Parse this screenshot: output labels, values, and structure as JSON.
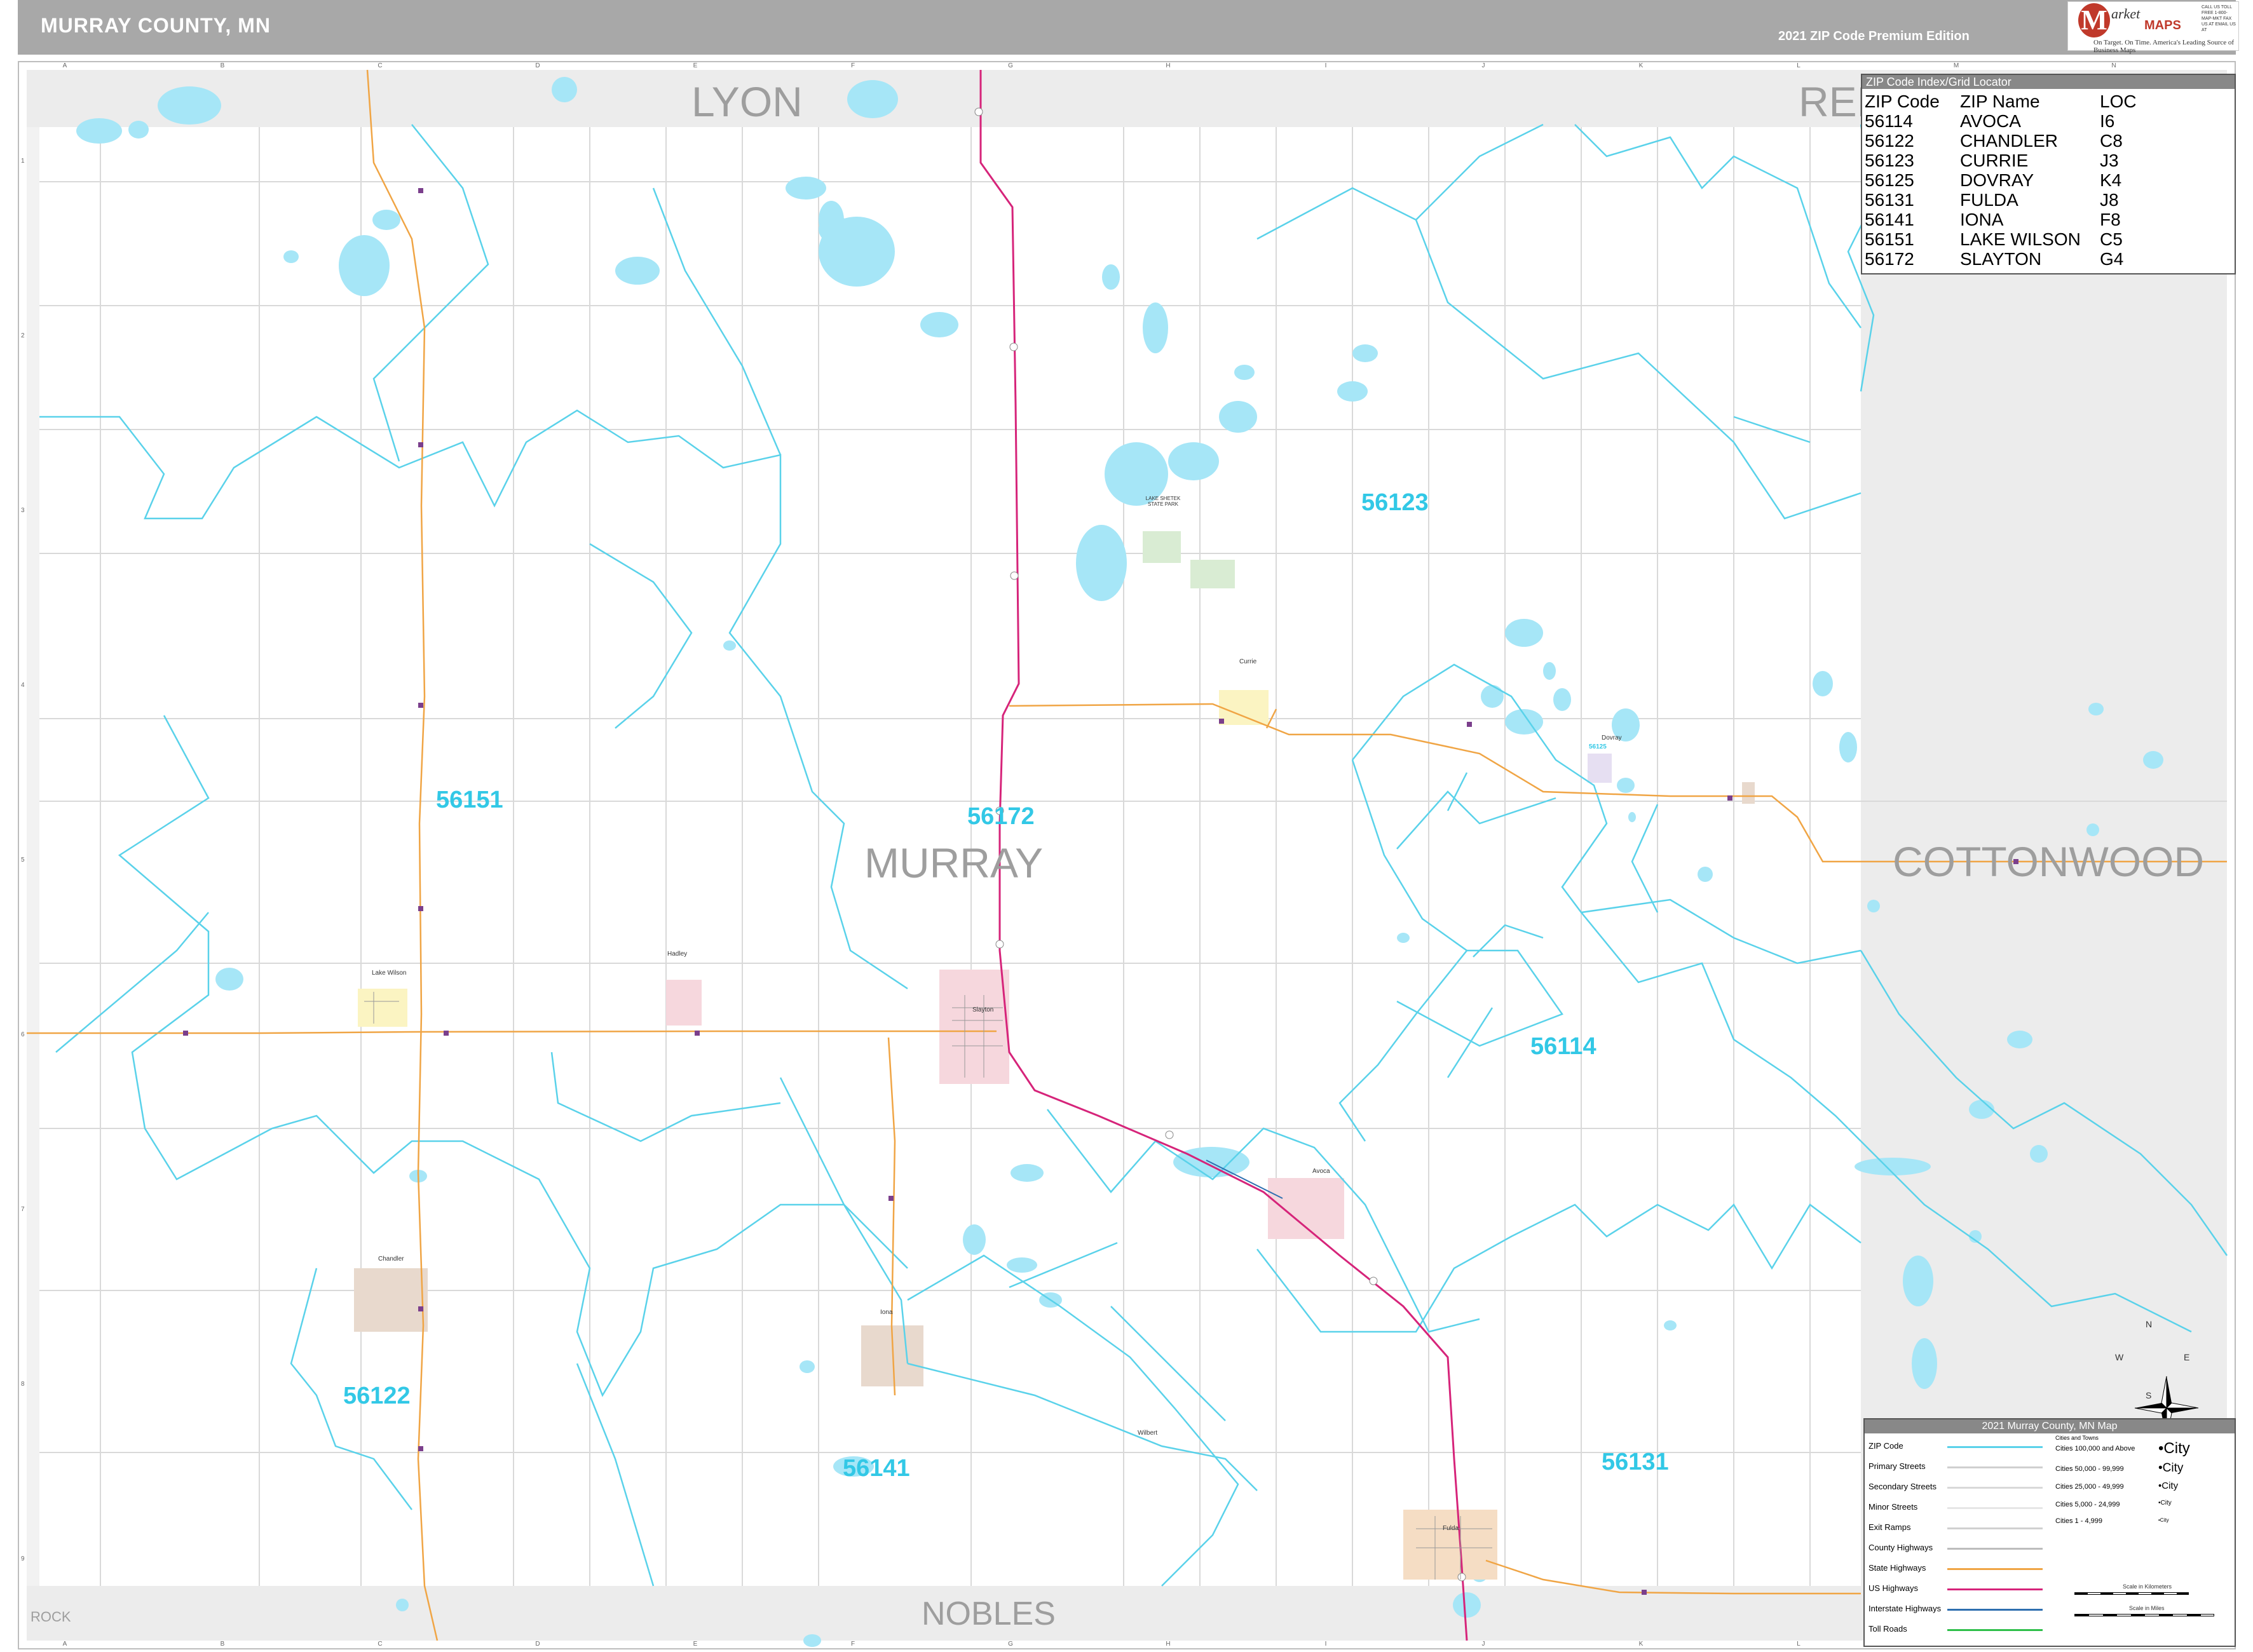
{
  "header": {
    "title": "MURRAY COUNTY, MN",
    "edition": "2021 ZIP Code Premium Edition"
  },
  "logo": {
    "letter": "M",
    "brand_line1": "arket",
    "brand_line2": "MAPS",
    "tagline": "On Target. On Time. America's Leading Source of Business Maps",
    "contact": "CALL US TOLL FREE 1-800-MAP-MKT FAX US AT EMAIL US AT"
  },
  "grid": {
    "columns": [
      "A",
      "B",
      "C",
      "D",
      "E",
      "F",
      "G",
      "H",
      "I",
      "J",
      "K",
      "L",
      "M",
      "N"
    ],
    "rows": [
      "1",
      "2",
      "3",
      "4",
      "5",
      "6",
      "7",
      "8",
      "9"
    ]
  },
  "counties": {
    "main": "MURRAY",
    "north": "LYON",
    "northeast": "RED",
    "east": "COTTONWOOD",
    "south": "NOBLES",
    "southwest": "ROCK"
  },
  "zip_labels": [
    {
      "zip": "56123"
    },
    {
      "zip": "56151"
    },
    {
      "zip": "56172"
    },
    {
      "zip": "56114"
    },
    {
      "zip": "56122"
    },
    {
      "zip": "56141"
    },
    {
      "zip": "56131"
    }
  ],
  "place_labels": {
    "slayton": "Slayton",
    "lake_wilson": "Lake Wilson",
    "currie": "Currie",
    "avoca": "Avoca",
    "chandler": "Chandler",
    "iona": "Iona",
    "fulda": "Fulda",
    "dovray": "Dovray",
    "hadley": "Hadley",
    "ww": "Wilbert",
    "park": "LAKE SHETEK STATE PARK",
    "dovray_zip": "56125"
  },
  "zip_index": {
    "title": "ZIP Code Index/Grid Locator",
    "headers": {
      "zip": "ZIP Code",
      "name": "ZIP Name",
      "loc": "LOC"
    },
    "rows": [
      {
        "zip": "56114",
        "name": "AVOCA",
        "loc": "I6"
      },
      {
        "zip": "56122",
        "name": "CHANDLER",
        "loc": "C8"
      },
      {
        "zip": "56123",
        "name": "CURRIE",
        "loc": "J3"
      },
      {
        "zip": "56125",
        "name": "DOVRAY",
        "loc": "K4"
      },
      {
        "zip": "56131",
        "name": "FULDA",
        "loc": "J8"
      },
      {
        "zip": "56141",
        "name": "IONA",
        "loc": "F8"
      },
      {
        "zip": "56151",
        "name": "LAKE WILSON",
        "loc": "C5"
      },
      {
        "zip": "56172",
        "name": "SLAYTON",
        "loc": "G4"
      }
    ]
  },
  "legend": {
    "title": "2021 Murray County, MN Map",
    "items": [
      {
        "label": "ZIP Code",
        "color": "#5ad2ea"
      },
      {
        "label": "Primary Streets",
        "color": "#cfcfcf"
      },
      {
        "label": "Secondary Streets",
        "color": "#d9d9d9"
      },
      {
        "label": "Minor Streets",
        "color": "#e6e6e6"
      },
      {
        "label": "Exit Ramps",
        "color": "#d0d0d0"
      },
      {
        "label": "County Highways",
        "color": "#bdbdbd"
      },
      {
        "label": "State Highways",
        "color": "#f0a545"
      },
      {
        "label": "US Highways",
        "color": "#d6247a"
      },
      {
        "label": "Interstate Highways",
        "color": "#2f6fb0"
      },
      {
        "label": "Toll Roads",
        "color": "#2fbf4a"
      }
    ],
    "cities": [
      {
        "label": "Cities 100,000 and Above",
        "sample": "•City"
      },
      {
        "label": "Cities 50,000 - 99,999",
        "sample": "•City"
      },
      {
        "label": "Cities 25,000 - 49,999",
        "sample": "•City"
      },
      {
        "label": "Cities 5,000 - 24,999",
        "sample": "•City"
      },
      {
        "label": "Cities 1 - 4,999",
        "sample": "•City"
      }
    ],
    "cities_header": "Cities and Towns",
    "scale_km": "Scale in Kilometers",
    "scale_mi": "Scale in Miles"
  },
  "compass": {
    "n": "N",
    "s": "S",
    "e": "E",
    "w": "W"
  },
  "colors": {
    "water": "#a6e6f7",
    "zip_boundary": "#5ad2ea",
    "state_highway": "#f0a545",
    "us_highway": "#d6247a",
    "road": "#d4d4d4",
    "neighbor": "#ececec"
  }
}
